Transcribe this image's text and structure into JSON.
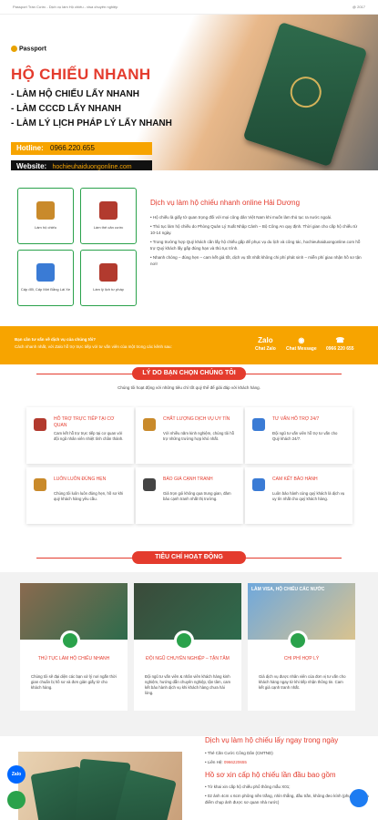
{
  "topbar": {
    "left": "Passport Trần Cước - Dịch vụ làm Hộ chiếu - visa chuyên nghiệp",
    "right": "@ 2017"
  },
  "hero": {
    "logo": "Passport",
    "title": "HỘ CHIẾU NHANH",
    "lines": [
      "- LÀM HỘ CHIẾU LẤY NHANH",
      "- LÀM CCCD LẤY NHANH",
      "- LÀM LÝ LỊCH PHÁP LÝ LẤY NHANH"
    ],
    "hotline_label": "Hotline:",
    "hotline": "0966.220.655",
    "website_label": "Website:",
    "website": "hochieuhaiduongonline.com"
  },
  "services": [
    {
      "label": "Làm hộ chiếu",
      "color": "#c98a2b"
    },
    {
      "label": "Làm thẻ căn cước",
      "color": "#b23a2e"
    },
    {
      "label": "Cấp đổi, Cấp Mới Bằng Lái Xe",
      "color": "#3a7bd5"
    },
    {
      "label": "Làm lý lịch tư pháp",
      "color": "#b23a2e"
    }
  ],
  "intro": {
    "heading": "Dịch vụ làm hộ chiếu nhanh online Hải Dương",
    "bullets": [
      "Hộ chiếu là giấy tờ quan trọng đối với mọi công dân Việt Nam khi muốn làm thủ tục ra nước ngoài.",
      "Thủ tục làm hộ chiếu do Phòng Quản Lý Xuất Nhập Cảnh – Bộ Công An quy định. Thời gian cho cấp hộ chiếu từ 10-14 ngày.",
      "Trong trường hợp Quý khách cần lấy hộ chiếu gấp để phục vụ du lịch và công tác, hochieuhaiduongonline.com hỗ trợ Quý khách lấy gấp đúng hạn và thủ tục trình.",
      "Nhanh chóng – đúng hẹn – cam kết giá tốt, dịch vụ tốt nhất không chi phí phát sinh – miễn phí giao nhận hồ sơ tận nơi!"
    ]
  },
  "cta": {
    "line1": "Bạn cần tư vấn về dịch vụ của chúng tôi?",
    "line2": "Cách nhanh nhất, với Zalo hỗ trợ trực tiếp với tư vấn viên của một trong các kênh sau:",
    "channels": [
      {
        "icon": "Zalo",
        "label": "Chat Zalo"
      },
      {
        "icon": "◉",
        "label": "Chat Message"
      },
      {
        "icon": "☎",
        "label": "0966 220 655"
      }
    ]
  },
  "why": {
    "title": "LÝ DO BẠN CHỌN CHÚNG TÔI",
    "subtitle": "Chúng tôi hoạt động với những tiêu chí tốt quý thể để giải đáp với khách hàng.",
    "cards": [
      {
        "title": "HỖ TRỢ TRỰC TIẾP TẠI CƠ QUAN",
        "text": "Cam kết hỗ trợ trực tiếp tại cơ quan với đội ngũ nhân viên nhiệt tình chân thành.",
        "color": "#b23a2e"
      },
      {
        "title": "CHẤT LƯỢNG DỊCH VỤ UY TÍN",
        "text": "Với nhiều năm kinh nghiệm, chúng tôi hỗ trợ những trường hợp khó nhất.",
        "color": "#c98a2b"
      },
      {
        "title": "TƯ VẤN HỖ TRỢ 24/7",
        "text": "Đội ngũ tư vấn viên hỗ trợ tư vấn cho Quý khách 24/7.",
        "color": "#3a7bd5"
      },
      {
        "title": "LUÔN LUÔN ĐÚNG HẸN",
        "text": "Chúng tôi luôn luôn đúng hẹn, hồ sơ khi quý khách hàng yêu cầu.",
        "color": "#c98a2b"
      },
      {
        "title": "BÁO GIÁ CẠNH TRANH",
        "text": "Giá trọn gói không qua trung gian, đảm bảo cạnh tranh nhất thị trường.",
        "color": "#444444"
      },
      {
        "title": "CAM KẾT BẢO HÀNH",
        "text": "Luôn bảo hành cùng quý khách là dịch vụ uy tín nhất cho quý khách hàng.",
        "color": "#3a7bd5"
      }
    ]
  },
  "ops": {
    "title": "TIÊU CHÍ HOẠT ĐỘNG",
    "items": [
      {
        "title": "THỦ TỤC LÀM HỘ CHIẾU NHANH",
        "text": "Chúng tôi sẽ đại diện các bạn xử lý nơi ngắn thời gian chuẩn bị hồ sơ và đơn giản giấy tờ cho khách hàng.",
        "img1": "#8a6a4f",
        "img2": "#2e6b4c"
      },
      {
        "title": "ĐỘI NGŨ CHUYÊN NGHIỆP – TẬN TÂM",
        "text": "Đội ngũ tư vấn viên & nhân viên khách hàng kinh nghiệm, hướng dẫn chuyên nghiệp, tận tâm, cam kết bảo hành dịch vụ khi khách hàng chưa hài lòng.",
        "img1": "#3b4a3a",
        "img2": "#2e6b4c"
      },
      {
        "title": "CHI PHÍ HỢP LÝ",
        "text": "Giá dịch vụ được nhân viên của đơn vị tư vấn cho khách hàng ngay từ khi tiếp nhận thông tin. Cam kết giá cạnh tranh nhất.",
        "img1": "#6fa8dc",
        "img2": "#d9c38f"
      }
    ],
    "visa_banner": "LÀM VISA, HỘ CHIẾU CÁC NƯỚC"
  },
  "bottom": {
    "heading": "Dịch vụ làm hộ chiếu lấy ngay trong ngày",
    "list": [
      {
        "label": "Thẻ Căn Cước Công Dân (CMTND)",
        "value": ""
      },
      {
        "label": "Liên Hệ: ",
        "value": "0966220655"
      }
    ],
    "subheading": "Hồ sơ xin cấp hộ chiếu lần đầu bao gồm",
    "sublist": [
      "Tờ khai xin cấp hộ chiếu phổ thông mẫu X01;",
      "02 ảnh 4cm x 6cm phông nền trắng, nhìn thẳng, đầu trần, không đeo kính (phụ lục trả đa điểm chụp ảnh được sơ quan nhà nước)"
    ]
  },
  "floats": {
    "zalo": "Zalo"
  }
}
